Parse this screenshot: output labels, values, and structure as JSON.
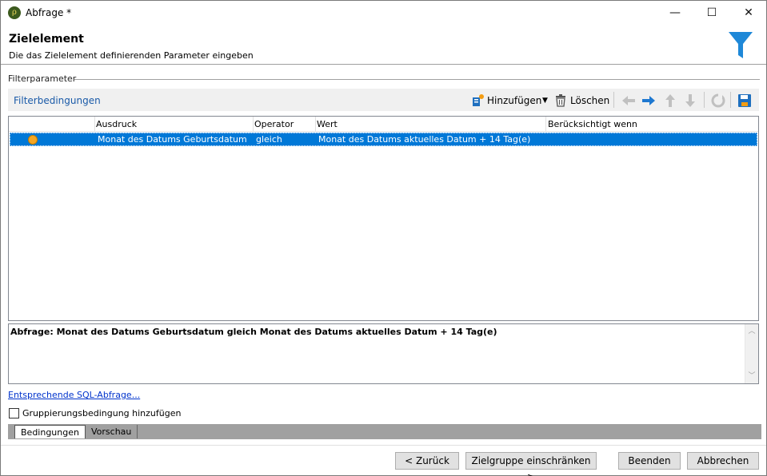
{
  "window": {
    "title": "Abfrage *",
    "app_icon_glyph": "ρ",
    "controls": {
      "minimize": "—",
      "maximize": "☐",
      "close": "✕"
    }
  },
  "header": {
    "title": "Zielelement",
    "subtitle": "Die das Zielelement definierenden Parameter eingeben",
    "icon": "funnel-icon",
    "icon_color": "#1e88d8"
  },
  "section": {
    "label": "Filterparameter"
  },
  "toolbar": {
    "label": "Filterbedingungen",
    "add_label": "Hinzufügen",
    "delete_label": "Löschen",
    "icons": [
      "add-condition-icon",
      "dropdown-arrow-icon",
      "trash-icon",
      "arrow-left-icon",
      "arrow-right-icon",
      "arrow-up-icon",
      "arrow-down-icon",
      "refresh-icon",
      "save-icon"
    ]
  },
  "grid": {
    "columns": [
      "Ausdruck",
      "Operator",
      "Wert",
      "Berücksichtigt wenn"
    ],
    "rows": [
      {
        "expression": "Monat des Datums Geburtsdatum",
        "operator": "gleich",
        "value": "Monat des Datums aktuelles Datum + 14 Tag(e)",
        "condition": ""
      }
    ],
    "selected_color": "#0078d7"
  },
  "query": {
    "text": "Abfrage: Monat des Datums Geburtsdatum gleich Monat des Datums aktuelles Datum + 14 Tag(e)"
  },
  "sql_link": "Entsprechende SQL-Abfrage...",
  "grouping_checkbox": {
    "label": "Gruppierungsbedingung hinzufügen",
    "checked": false
  },
  "tabs": [
    {
      "label": "Bedingungen",
      "active": true
    },
    {
      "label": "Vorschau",
      "active": false
    }
  ],
  "buttons": {
    "back": "< Zurück",
    "next": "Zielgruppe einschränken >",
    "finish": "Beenden",
    "cancel": "Abbrechen"
  }
}
